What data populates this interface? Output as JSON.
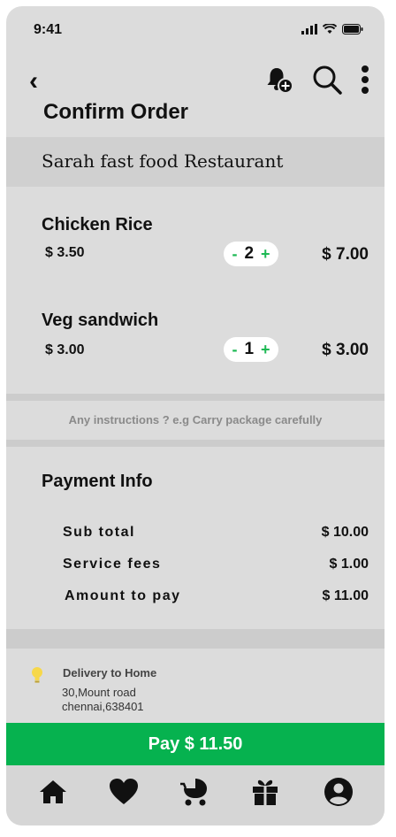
{
  "status": {
    "time": "9:41"
  },
  "header": {
    "title": "Confirm Order"
  },
  "restaurant": {
    "name": "Sarah fast food Restaurant"
  },
  "items": [
    {
      "name": "Chicken Rice",
      "price": "$ 3.50",
      "quantity": "2",
      "total": "$ 7.00"
    },
    {
      "name": "Veg sandwich",
      "price": "$ 3.00",
      "quantity": "1",
      "total": "$ 3.00"
    }
  ],
  "qty_controls": {
    "minus": "-",
    "plus": "+"
  },
  "instructions": {
    "placeholder": "Any instructions ? e.g Carry package carefully"
  },
  "payment": {
    "title": "Payment Info",
    "rows": [
      {
        "label": "Sub total",
        "value": "$ 10.00"
      },
      {
        "label": "Service fees",
        "value": "$ 1.00"
      },
      {
        "label": "Amount to pay",
        "value": "$ 11.00"
      }
    ]
  },
  "delivery": {
    "title": "Delivery to Home",
    "address_line1": "30,Mount road",
    "address_line2": "chennai,638401"
  },
  "pay_button": {
    "label": "Pay $ 11.50"
  },
  "colors": {
    "accent": "#06b24f",
    "qty_sign": "#1db954",
    "background": "#dcdcdc"
  },
  "tabbar": {
    "icons": [
      "home-icon",
      "heart-icon",
      "stroller-icon",
      "gift-icon",
      "profile-icon"
    ]
  }
}
